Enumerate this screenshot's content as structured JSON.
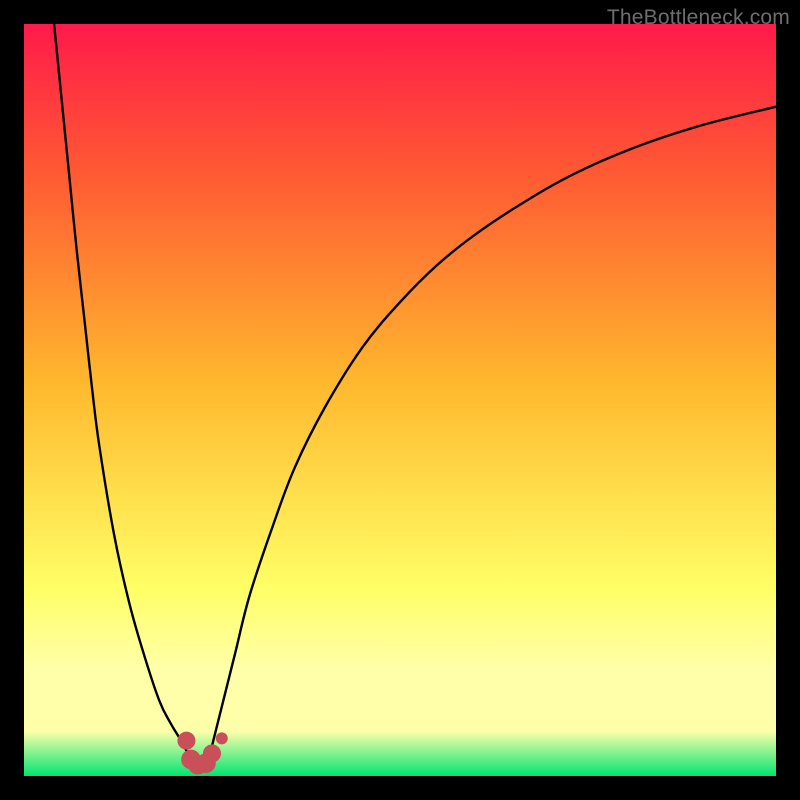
{
  "attribution": "TheBottleneck.com",
  "colors": {
    "gradient_top": "#ff1a4a",
    "gradient_mid_high": "#ff5a33",
    "gradient_mid": "#ffb92e",
    "gradient_low_yellow": "#ffff66",
    "gradient_pale": "#ffffaa",
    "gradient_green": "#00e571",
    "curve": "#000000",
    "marker": "#c94f59",
    "frame": "#000000"
  },
  "chart_data": {
    "type": "line",
    "title": "",
    "xlabel": "",
    "ylabel": "",
    "xlim": [
      0,
      100
    ],
    "ylim": [
      0,
      100
    ],
    "grid": false,
    "legend": false,
    "annotations": [],
    "series": [
      {
        "name": "left-branch",
        "x": [
          4,
          5,
          6,
          7,
          8,
          9,
          10,
          12,
          14,
          16,
          18,
          19.5,
          21,
          22.3
        ],
        "y": [
          100,
          90,
          80,
          70,
          61,
          52,
          44,
          32,
          23,
          16,
          10,
          7,
          4.5,
          2
        ]
      },
      {
        "name": "right-branch",
        "x": [
          24.5,
          25,
          26,
          28,
          30,
          33,
          36,
          40,
          45,
          50,
          55,
          60,
          66,
          73,
          81,
          90,
          100
        ],
        "y": [
          2,
          4,
          8,
          16,
          24,
          33,
          41,
          49,
          57,
          63,
          68,
          72,
          76,
          80,
          83.5,
          86.5,
          89
        ]
      }
    ],
    "markers": [
      {
        "name": "left-bump-top",
        "x": 21.6,
        "y": 4.7,
        "r": 1.2
      },
      {
        "name": "left-bump-bottom",
        "x": 22.2,
        "y": 2.2,
        "r": 1.3
      },
      {
        "name": "trough-left",
        "x": 23.1,
        "y": 1.5,
        "r": 1.3
      },
      {
        "name": "trough-right",
        "x": 24.2,
        "y": 1.7,
        "r": 1.3
      },
      {
        "name": "right-bump",
        "x": 25.0,
        "y": 3.0,
        "r": 1.2
      },
      {
        "name": "small-dot",
        "x": 26.3,
        "y": 5.0,
        "r": 0.8
      }
    ],
    "valley_x": 23.4
  }
}
